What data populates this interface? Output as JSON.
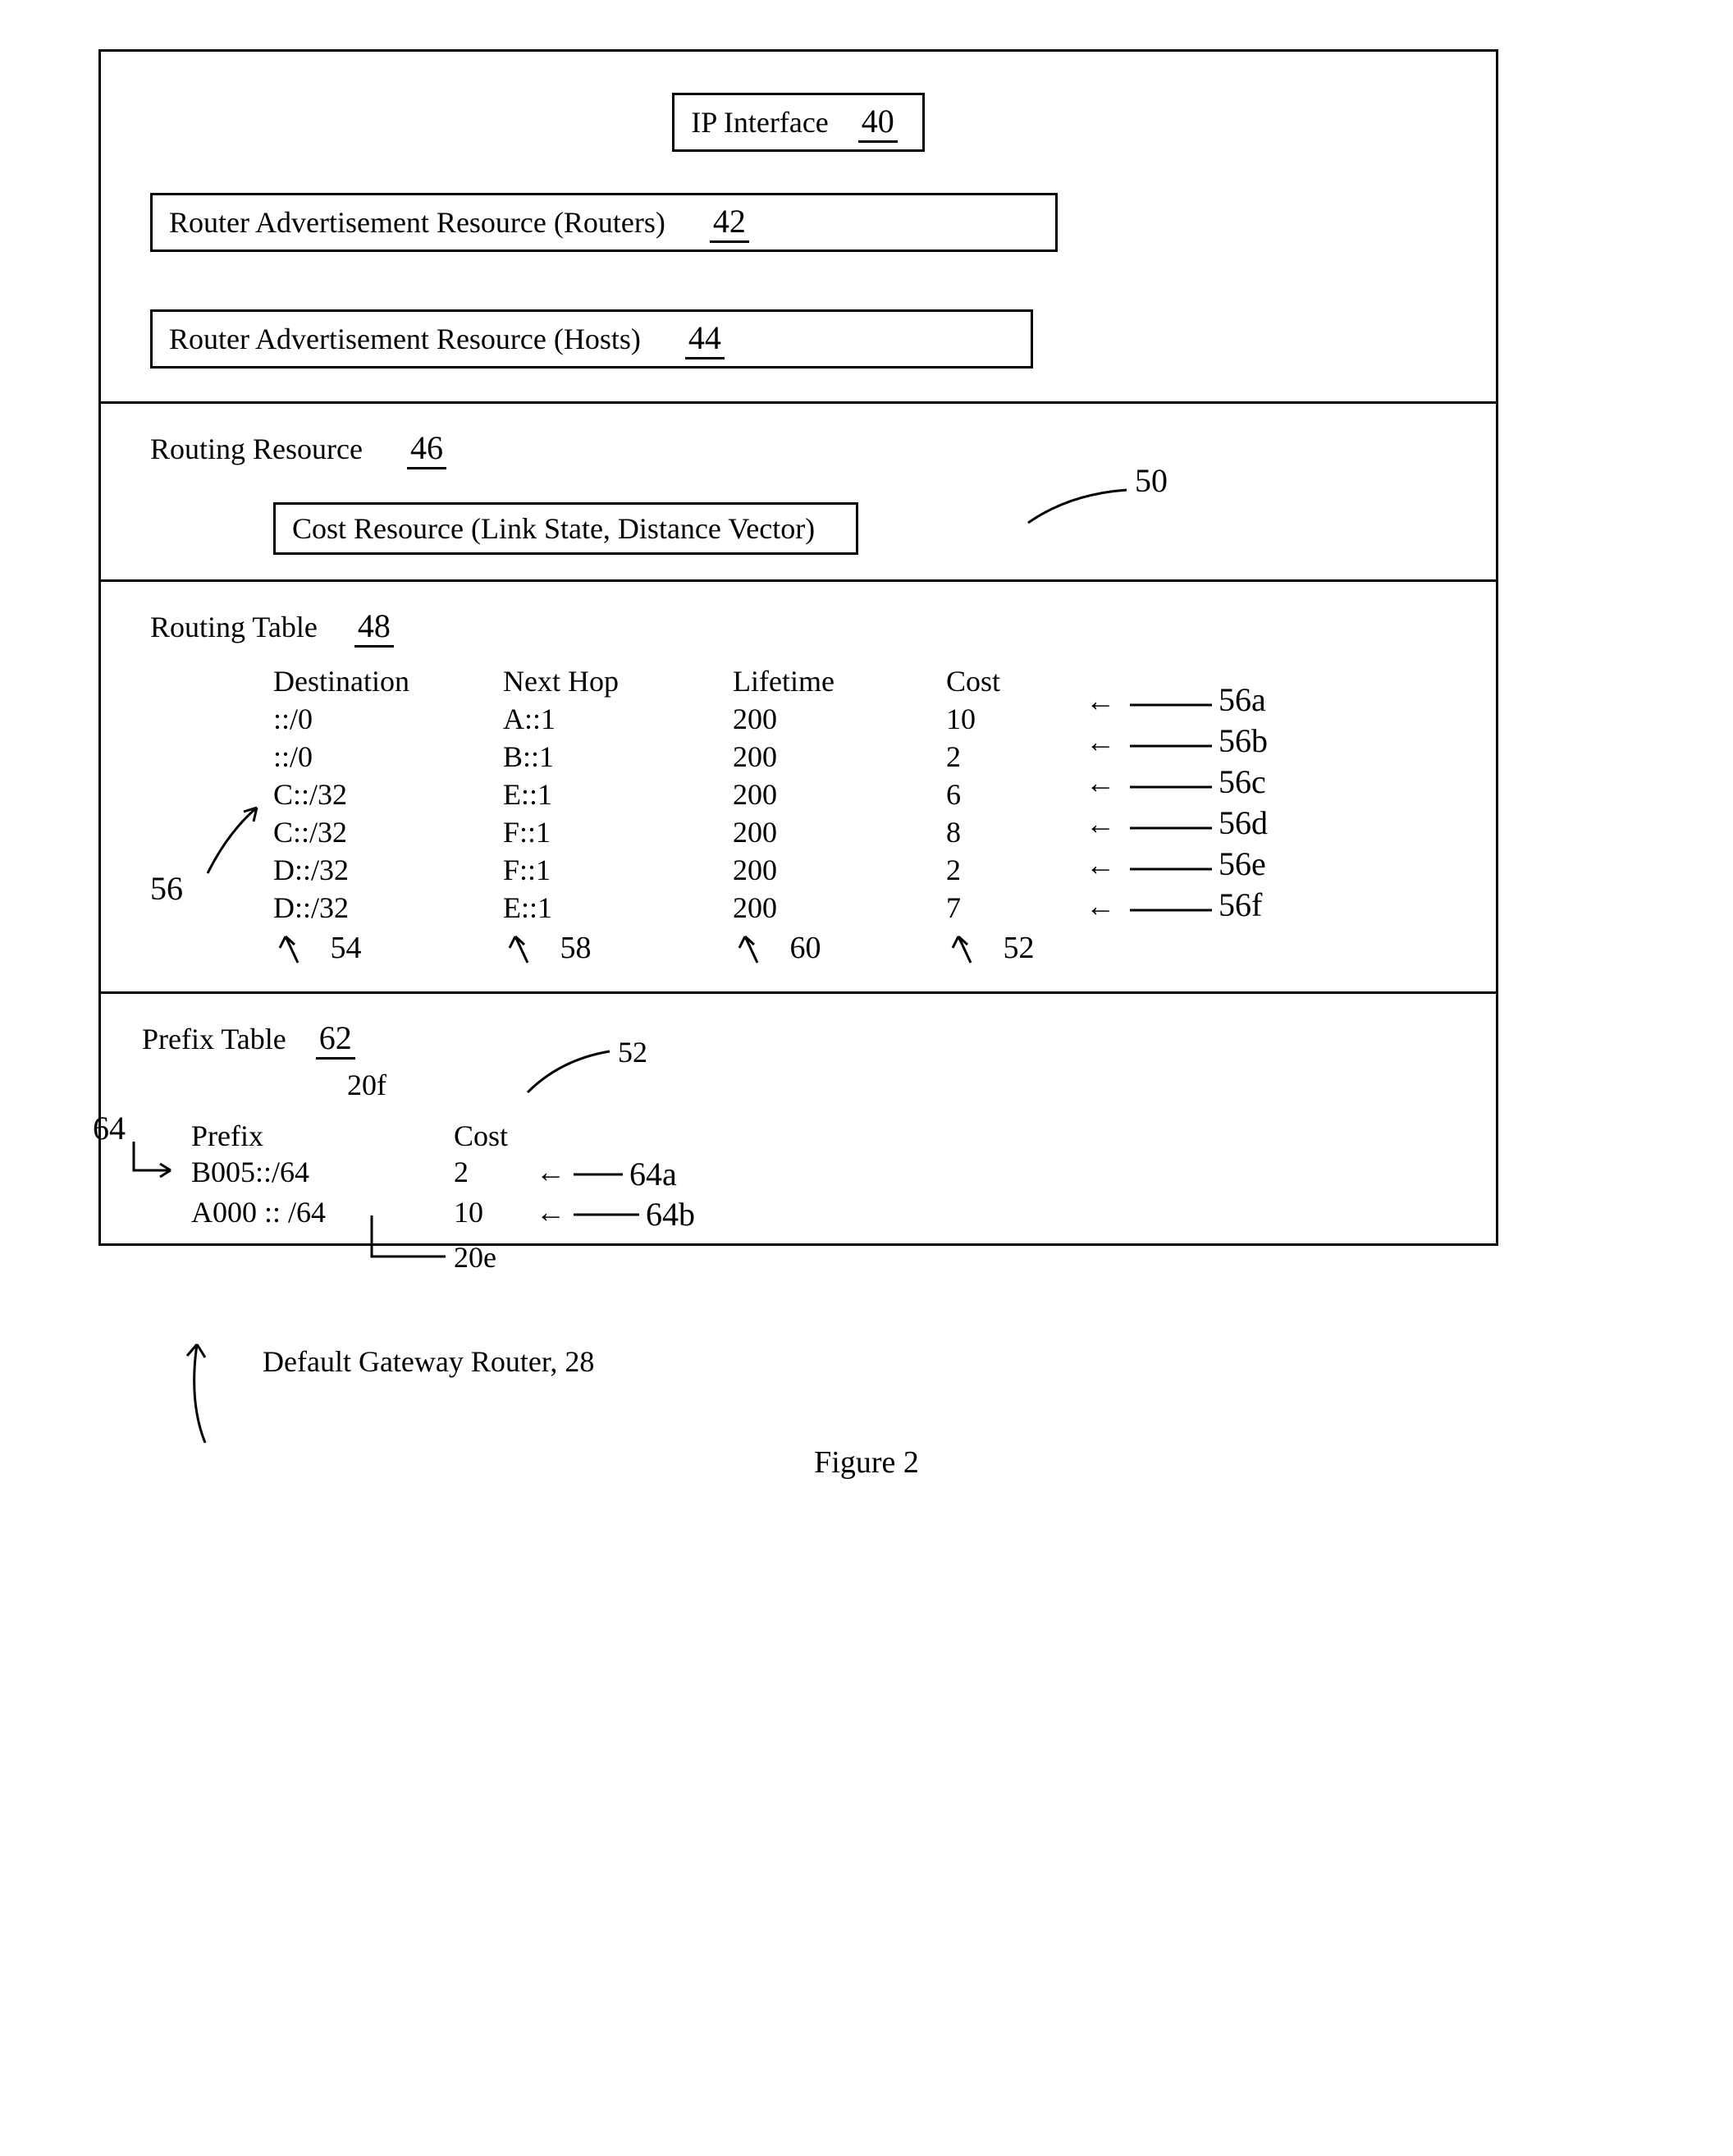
{
  "title_box": {
    "label": "IP Interface",
    "ref": "40"
  },
  "rar_routers": {
    "label": "Router Advertisement Resource (Routers)",
    "ref": "42"
  },
  "rar_hosts": {
    "label": "Router Advertisement Resource (Hosts)",
    "ref": "44"
  },
  "routing_resource": {
    "label": "Routing Resource",
    "ref": "46"
  },
  "cost_resource": {
    "label": "Cost Resource (Link State, Distance Vector)",
    "ref": "50"
  },
  "routing_table": {
    "label": "Routing Table",
    "ref": "48",
    "headers": {
      "dest": "Destination",
      "next": "Next Hop",
      "life": "Lifetime",
      "cost": "Cost"
    },
    "rows": [
      {
        "dest": "::/0",
        "next": "A::1",
        "life": "200",
        "cost": "10",
        "row_ref": "56a"
      },
      {
        "dest": "::/0",
        "next": "B::1",
        "life": "200",
        "cost": "2",
        "row_ref": "56b"
      },
      {
        "dest": "C::/32",
        "next": "E::1",
        "life": "200",
        "cost": "6",
        "row_ref": "56c"
      },
      {
        "dest": "C::/32",
        "next": "F::1",
        "life": "200",
        "cost": "8",
        "row_ref": "56d"
      },
      {
        "dest": "D::/32",
        "next": "F::1",
        "life": "200",
        "cost": "2",
        "row_ref": "56e"
      },
      {
        "dest": "D::/32",
        "next": "E::1",
        "life": "200",
        "cost": "7",
        "row_ref": "56f"
      }
    ],
    "col_refs": {
      "dest": "54",
      "next": "58",
      "life": "60",
      "cost": "52"
    },
    "group_ref": "56"
  },
  "prefix_table": {
    "label": "Prefix Table",
    "ref": "62",
    "headers": {
      "prefix": "Prefix",
      "cost": "Cost"
    },
    "header_refs": {
      "prefix_small": "20f",
      "cost_small": "52"
    },
    "left_ref": "64",
    "rows": [
      {
        "prefix": "B005::/64",
        "cost": "2",
        "row_ref": "64a"
      },
      {
        "prefix": "A000 :: /64",
        "cost": "10",
        "row_ref": "64b"
      }
    ],
    "row2_tail_ref": "20e"
  },
  "bottom_caption": "Default Gateway Router, 28",
  "figure_label": "Figure 2"
}
